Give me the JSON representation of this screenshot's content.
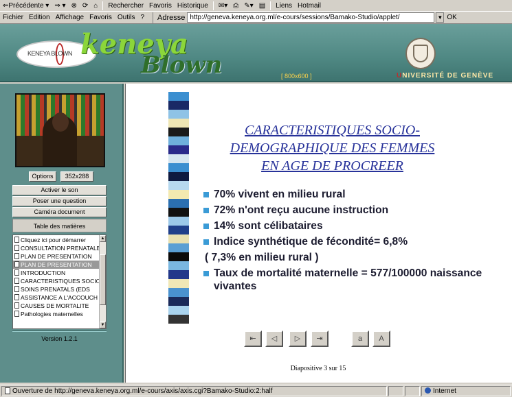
{
  "toolbar": {
    "back": "⇐Précédente ▾",
    "forward": "⇒ ▾",
    "search": "Rechercher",
    "favorites": "Favoris",
    "history": "Historique",
    "links": "Liens",
    "hotmail": "Hotmail"
  },
  "menu": {
    "items": [
      "Fichier",
      "Edition",
      "Affichage",
      "Favoris",
      "Outils",
      "?"
    ],
    "address_label": "Adresse",
    "address_value": "http://geneva.keneya.org.ml/e-cours/sessions/Bamako-Studio/applet/",
    "go": "OK"
  },
  "banner": {
    "ellipse_text": "KENEYA BLOWN",
    "logo_top": "keneya",
    "logo_bottom": "Blown",
    "resolution": "[ 800x600 ]",
    "university_u": "U",
    "university_rest": "NIVERSITÉ DE GENÈVE"
  },
  "sidebar": {
    "options_label": "Options",
    "resolution_label": "352x288",
    "activate_sound": "Activer le son",
    "ask_question": "Poser une question",
    "camera_doc": "Caméra document",
    "toc_title": "Table des matières",
    "toc_items": [
      "Cliquez ici pour démarrer",
      "CONSULTATION PRENATALE",
      "PLAN DE PRESENTATION",
      "PLAN DE PRESENTATION",
      "INTRODUCTION",
      "CARACTERISTIQUES SOCIO",
      "SOINS PRENATALS (EDS",
      "ASSISTANCE A L'ACCOUCH",
      "CAUSES DE MORTALITE",
      "Pathologies maternelles"
    ],
    "selected_index": 3,
    "version": "Version 1.2.1"
  },
  "slide": {
    "title_line1": "CARACTERISTIQUES SOCIO-",
    "title_line2": "DEMOGRAPHIQUE DES FEMMES",
    "title_line3": "EN AGE DE PROCREER",
    "bullets": [
      "70% vivent en milieu rural",
      "72% n'ont reçu aucune instruction",
      "14% sont célibataires",
      "Indice synthétique de fécondité= 6,8%",
      " ( 7,3% en milieu rural )",
      "Taux de mortalité maternelle = 577/100000 naissance vivantes"
    ],
    "bullet_markers": [
      true,
      true,
      true,
      true,
      false,
      true
    ],
    "nav_first": "⇤",
    "nav_prev": "◁",
    "nav_next": "▷",
    "nav_last": "⇥",
    "nav_a": "a",
    "nav_b": "A",
    "counter": "Diapositive 3 sur 15",
    "stripe_colors": [
      "#3b8fd0",
      "#1a2a66",
      "#8fc3e6",
      "#efe6b4",
      "#1a1a1a",
      "#6fb0dc",
      "#2a2a8a",
      "#d6e6f0",
      "#3b8fd0",
      "#0e1a40",
      "#b7d9ef",
      "#f3e9b0",
      "#2b6fb0",
      "#111",
      "#9cc9e9",
      "#1f3f8a",
      "#e8e0b0",
      "#5a9fd4",
      "#0a0a0a",
      "#7ab7e0",
      "#23388a",
      "#f0e7b6",
      "#4a92cf",
      "#1b2a5a",
      "#a9d3ee",
      "#333"
    ]
  },
  "status": {
    "text": "Ouverture de http://geneva.keneya.org.ml/e-cours/axis/axis.cgi?Bamako-Studio:2:half",
    "zone": "Internet"
  }
}
